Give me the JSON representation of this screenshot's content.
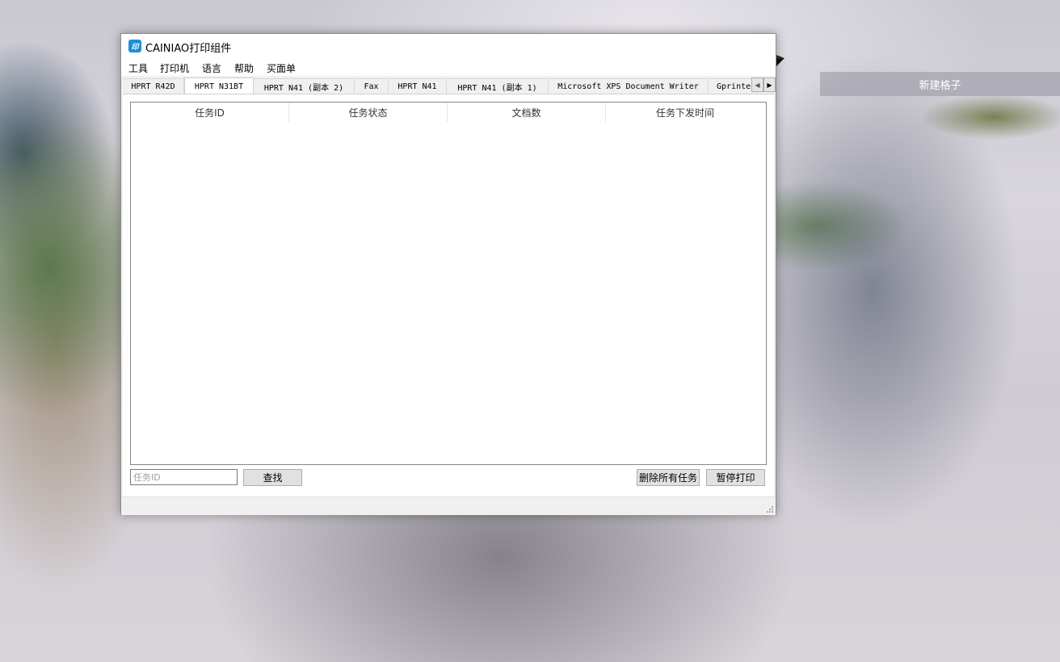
{
  "desktop": {
    "button_label": "新建格子"
  },
  "window": {
    "title": "CAINIAO打印组件",
    "icon_text": "印",
    "menu": [
      "工具",
      "打印机",
      "语言",
      "帮助",
      "买面单"
    ],
    "tabs": [
      {
        "label": "HPRT R42D",
        "active": false
      },
      {
        "label": "HPRT N31BT",
        "active": true
      },
      {
        "label": "HPRT N41 (副本 2)",
        "active": false
      },
      {
        "label": "Fax",
        "active": false
      },
      {
        "label": "HPRT N41",
        "active": false
      },
      {
        "label": "HPRT N41 (副本 1)",
        "active": false
      },
      {
        "label": "Microsoft XPS Document Writer",
        "active": false
      },
      {
        "label": "Gprinte",
        "active": false
      }
    ],
    "table": {
      "columns": [
        "任务ID",
        "任务状态",
        "文档数",
        "任务下发时间"
      ],
      "rows": []
    },
    "search": {
      "placeholder": "任务ID",
      "value": "",
      "button_label": "查找"
    },
    "actions": {
      "delete_all_label": "删除所有任务",
      "pause_label": "暂停打印"
    }
  },
  "colors": {
    "accent": "#1e8fd6",
    "window_bg": "#f0f0f0",
    "button_bg": "#e1e1e1"
  }
}
